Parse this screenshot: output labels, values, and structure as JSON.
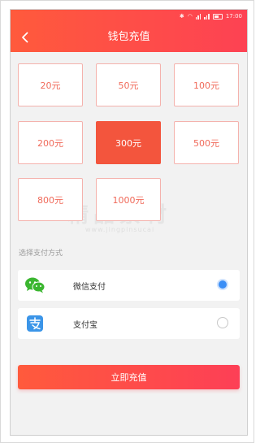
{
  "status_bar": {
    "time": "17:00"
  },
  "header": {
    "title": "钱包充值",
    "back_icon": "chevron-left-icon"
  },
  "amounts": {
    "selected_index": 4,
    "options": [
      "20元",
      "50元",
      "100元",
      "200元",
      "300元",
      "500元",
      "800元",
      "1000元"
    ]
  },
  "payment": {
    "section_label": "选择支付方式",
    "methods": [
      {
        "label": "微信支付",
        "icon": "wechat-icon",
        "checked": true
      },
      {
        "label": "支付宝",
        "icon": "alipay-icon",
        "checked": false
      }
    ]
  },
  "submit": {
    "label": "立即充值"
  },
  "colors": {
    "accent": "#f3553d",
    "header_gradient_start": "#ff5a3c",
    "header_gradient_end": "#fd4253",
    "option_border": "#f4b2ad",
    "option_text": "#f06a5a",
    "radio_checked": "#3a8ef6",
    "wechat_green": "#3bb630",
    "alipay_blue": "#3b95e8"
  }
}
